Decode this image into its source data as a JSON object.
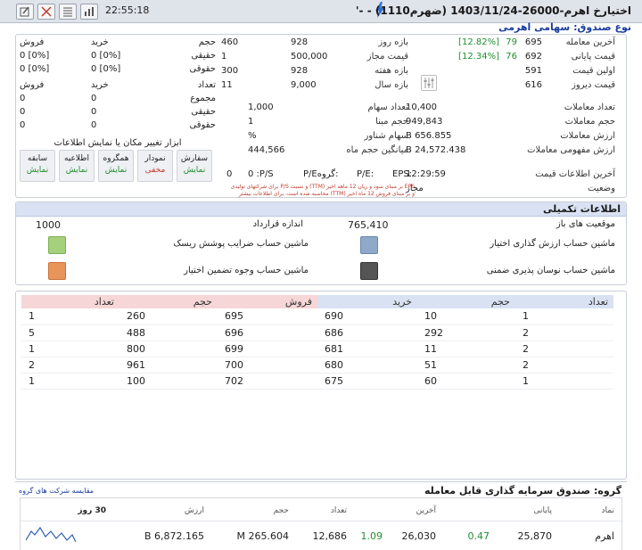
{
  "titlebar": {
    "time": "22:55:18",
    "title": "اختیارخ اهرم-26000-1403/11/24 (ضهرم1110) - -'"
  },
  "fund_type": "نوع صندوق: سهامی اهرمی",
  "prices": [
    {
      "label": "آخرین معامله",
      "value": "695",
      "change": "79",
      "pct": "[12.82%]"
    },
    {
      "label": "قیمت پایانی",
      "value": "692",
      "change": "76",
      "pct": "[12.34%]"
    },
    {
      "label": "اولین قیمت",
      "value": "591"
    },
    {
      "label": "قیمت دیروز",
      "value": "616"
    }
  ],
  "ranges": [
    {
      "label": "بازه روز",
      "a": "928",
      "b": "460"
    },
    {
      "label": "قیمت مجاز",
      "a": "500,000",
      "b": "1"
    },
    {
      "label": "بازه هفته",
      "a": "928",
      "b": "300"
    },
    {
      "label": "بازه سال",
      "a": "9,000",
      "b": "11"
    }
  ],
  "summary": {
    "headers": {
      "vol": "حجم",
      "buy": "خرید",
      "sell": "فروش"
    },
    "rows": [
      {
        "label": "حقیقی",
        "buy": "[0%] 0",
        "sell": "[0%] 0"
      },
      {
        "label": "حقوقی",
        "buy": "[0%] 0",
        "sell": "[0%] 0"
      }
    ],
    "count_label": "تعداد",
    "count_rows": [
      {
        "label": "مجموع",
        "buy": "0",
        "sell": "0"
      },
      {
        "label": "حقیقی",
        "buy": "0",
        "sell": "0"
      },
      {
        "label": "حقوقی",
        "buy": "0",
        "sell": "0"
      }
    ]
  },
  "stats": [
    {
      "label": "تعداد معاملات",
      "value": "10,400"
    },
    {
      "label": "حجم معاملات",
      "value": "949,843"
    },
    {
      "label": "ارزش معاملات",
      "value": "656.855 B"
    },
    {
      "label": "ارزش مفهومی معاملات",
      "value": "24,572.438 B"
    }
  ],
  "shares": [
    {
      "label": "تعداد سهام",
      "value": "1,000"
    },
    {
      "label": "حجم مبنا",
      "value": "1"
    },
    {
      "label": "سهام شناور",
      "value": "%"
    },
    {
      "label": "میانگین حجم ماه",
      "value": "444,566"
    }
  ],
  "info": {
    "last_update_label": "آخرین اطلاعات قیمت",
    "last_update": "12:29:59",
    "status_label": "وضعیت",
    "status": "مجاز",
    "eps": "EPS:",
    "pe": "P/E:",
    "group_pe": "P/Eگروه:",
    "ps": "0  :P/S",
    "ps2": "0",
    "zero": "0",
    "note1": "EPS بر مبنای سود و زیان 12 ماهه اخیر (TTM) و نسبت P/S برای شرکتهای تولیدی",
    "note2": "و بر مبنای فروش 12 ماه اخیر (TTM) محاسبه شده است. برای اطلاعات بیشتر"
  },
  "tools": {
    "title": "ابزار تغییر مکان یا نمایش اطلاعات",
    "items": [
      {
        "name": "سفارش",
        "state": "نمایش"
      },
      {
        "name": "نمودار",
        "state": "مخفی"
      },
      {
        "name": "همگروه",
        "state": "نمایش"
      },
      {
        "name": "اطلاعیه",
        "state": "نمایش"
      },
      {
        "name": "سابقه",
        "state": "نمایش"
      }
    ]
  },
  "extra": {
    "title": "اطلاعات تکمیلی",
    "open_pos_label": "موقعیت های باز",
    "open_pos": "765,410",
    "contract_label": "اندازه قرارداد",
    "contract": "1000",
    "calc1": "ماشین حساب ارزش گذاری اختیار",
    "calc2": "ماشین حساب ضرایب پوشش ریسک",
    "calc3": "ماشین حساب نوسان پذیری ضمنی",
    "calc4": "ماشین حساب وجوه تضمین اختیار"
  },
  "orderbook": {
    "headers": [
      "تعداد",
      "حجم",
      "خرید",
      "فروش",
      "حجم",
      "تعداد"
    ],
    "rows": [
      [
        "1",
        "10",
        "690",
        "695",
        "260",
        "1"
      ],
      [
        "2",
        "292",
        "686",
        "696",
        "488",
        "5"
      ],
      [
        "2",
        "11",
        "681",
        "699",
        "800",
        "1"
      ],
      [
        "2",
        "51",
        "680",
        "700",
        "961",
        "2"
      ],
      [
        "1",
        "60",
        "675",
        "702",
        "100",
        "1"
      ]
    ]
  },
  "group": {
    "title": "گروه: صندوق سرمایه گذاری قابل معامله",
    "compare_link": "مقایسه شرکت های گروه",
    "headers": [
      "نماد",
      "پایانی",
      "",
      "آخرین",
      "",
      "تعداد",
      "حجم",
      "ارزش",
      "30 روز"
    ],
    "row": [
      "اهرم",
      "25,870",
      "0.47",
      "26,030",
      "1.09",
      "12,686",
      "265.604 M",
      "6,872.165 B"
    ]
  },
  "colors": {
    "buy": "#d9e2f3",
    "sell": "#f6d6d6",
    "green": "#1f8e2e",
    "red": "#c0392b"
  }
}
